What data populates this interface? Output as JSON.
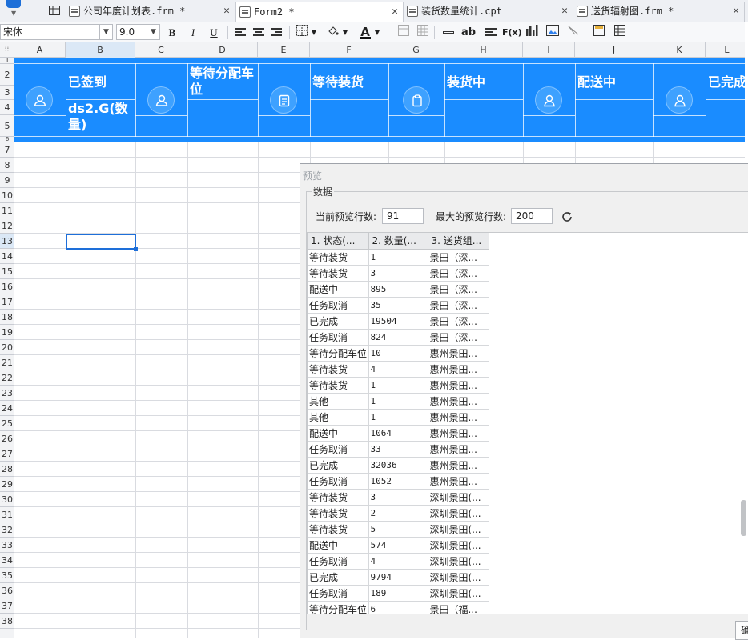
{
  "tabs": [
    {
      "label": "公司年度计划表.frm *",
      "active": false
    },
    {
      "label": "Form2 *",
      "active": true
    },
    {
      "label": "装货数量统计.cpt",
      "active": false
    },
    {
      "label": "送货辐射图.frm *",
      "active": false
    }
  ],
  "toolbar": {
    "font_family": "宋体",
    "font_size": "9.0",
    "bold": "B",
    "italic": "I",
    "underline": "U",
    "text_label": "ab",
    "formula_label": "F(x)"
  },
  "columns": [
    "A",
    "B",
    "C",
    "D",
    "E",
    "F",
    "G",
    "H",
    "I",
    "J",
    "K",
    "L"
  ],
  "rows": [
    "1",
    "2",
    "3",
    "4",
    "5",
    "6",
    "7",
    "8",
    "9",
    "10",
    "11",
    "12",
    "13",
    "14",
    "15",
    "16",
    "17",
    "18",
    "19",
    "20",
    "21",
    "22",
    "23",
    "24",
    "25",
    "26",
    "27",
    "28",
    "29",
    "30",
    "31",
    "32",
    "33",
    "34",
    "35",
    "36",
    "37",
    "38"
  ],
  "banner": {
    "items": [
      "已签到",
      "等待分配车位",
      "等待装货",
      "装货中",
      "配送中",
      "已完成"
    ],
    "formula": "ds2.G(数量)"
  },
  "preview": {
    "title": "预览",
    "group_label": "数据",
    "current_rows_label": "当前预览行数:",
    "current_rows_value": "91",
    "max_rows_label": "最大的预览行数:",
    "max_rows_value": "200",
    "headers": [
      "1. 状态(...",
      "2. 数量(...",
      "3. 送货组..."
    ],
    "rows": [
      [
        "等待装货",
        "1",
        "景田（深..."
      ],
      [
        "等待装货",
        "3",
        "景田（深..."
      ],
      [
        "配送中",
        "895",
        "景田（深..."
      ],
      [
        "任务取消",
        "35",
        "景田（深..."
      ],
      [
        "已完成",
        "19504",
        "景田（深..."
      ],
      [
        "任务取消",
        "824",
        "景田（深..."
      ],
      [
        "等待分配车位",
        "10",
        "惠州景田..."
      ],
      [
        "等待装货",
        "4",
        "惠州景田..."
      ],
      [
        "等待装货",
        "1",
        "惠州景田..."
      ],
      [
        "其他",
        "1",
        "惠州景田..."
      ],
      [
        "其他",
        "1",
        "惠州景田..."
      ],
      [
        "配送中",
        "1064",
        "惠州景田..."
      ],
      [
        "任务取消",
        "33",
        "惠州景田..."
      ],
      [
        "已完成",
        "32036",
        "惠州景田..."
      ],
      [
        "任务取消",
        "1052",
        "惠州景田..."
      ],
      [
        "等待装货",
        "3",
        "深圳景田(..."
      ],
      [
        "等待装货",
        "2",
        "深圳景田(..."
      ],
      [
        "等待装货",
        "5",
        "深圳景田(..."
      ],
      [
        "配送中",
        "574",
        "深圳景田(..."
      ],
      [
        "任务取消",
        "4",
        "深圳景田(..."
      ],
      [
        "已完成",
        "9794",
        "深圳景田(..."
      ],
      [
        "任务取消",
        "189",
        "深圳景田(..."
      ],
      [
        "等待分配车位",
        "6",
        "景田（福..."
      ]
    ],
    "ok_button": "确"
  },
  "colors": {
    "accent": "#1a8cff",
    "selection": "#1e6fd9"
  }
}
